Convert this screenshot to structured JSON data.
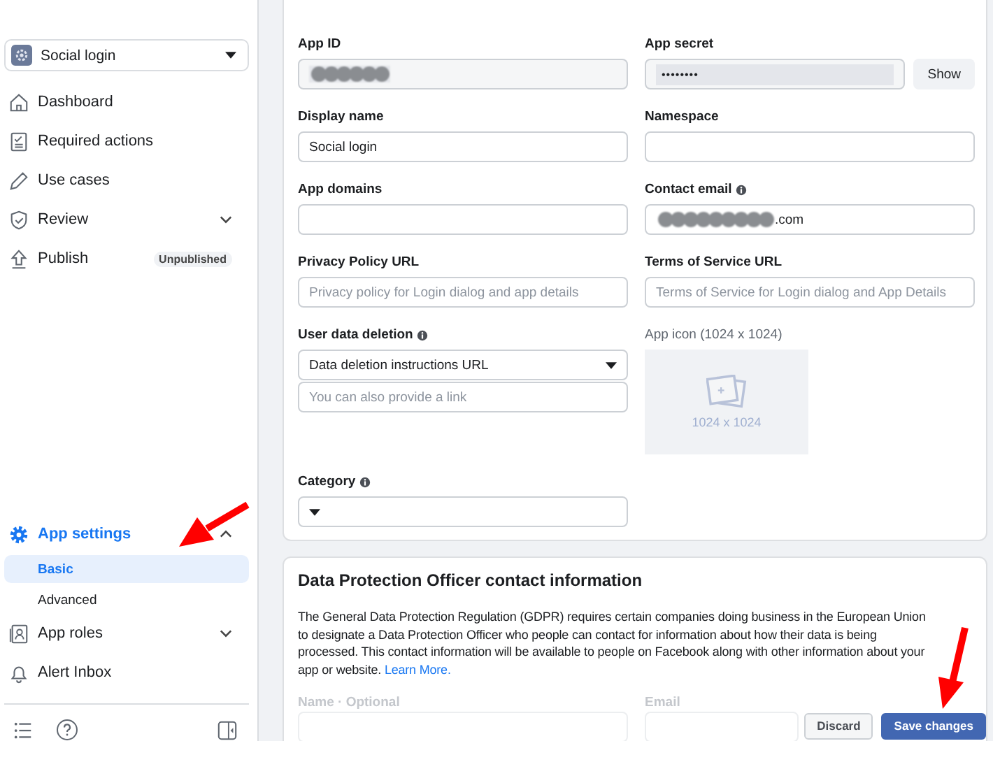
{
  "app_selector": {
    "name": "Social login"
  },
  "nav": [
    {
      "label": "Dashboard"
    },
    {
      "label": "Required actions"
    },
    {
      "label": "Use cases"
    },
    {
      "label": "Review",
      "expandable": true,
      "expanded": false
    },
    {
      "label": "Publish",
      "badge": "Unpublished"
    }
  ],
  "settings_nav": {
    "label": "App settings",
    "expanded": true,
    "children": [
      {
        "label": "Basic",
        "selected": true
      },
      {
        "label": "Advanced",
        "selected": false
      }
    ]
  },
  "nav_bottom": [
    {
      "label": "App roles",
      "expandable": true,
      "expanded": false
    },
    {
      "label": "Alert Inbox"
    }
  ],
  "basic_form": {
    "rows": [
      [
        {
          "label": "App ID",
          "kind": "text",
          "readonly": true,
          "redacted": true
        },
        {
          "label": "App secret",
          "kind": "secret",
          "readonly": true,
          "value": "••••••••",
          "button": "Show"
        }
      ],
      [
        {
          "label": "Display name",
          "kind": "text",
          "value": "Social login"
        },
        {
          "label": "Namespace",
          "kind": "text"
        }
      ],
      [
        {
          "label": "App domains",
          "kind": "text"
        },
        {
          "label": "Contact email",
          "kind": "text",
          "info": true,
          "redacted": true,
          "value": ".com"
        }
      ],
      [
        {
          "label": "Privacy Policy URL",
          "kind": "text",
          "placeholder": "Privacy policy for Login dialog and app details"
        },
        {
          "label": "Terms of Service URL",
          "kind": "text",
          "placeholder": "Terms of Service for Login dialog and App Details"
        }
      ],
      [
        {
          "label": "User data deletion",
          "kind": "select_input",
          "info": true,
          "value": "Data deletion instructions URL",
          "placeholder": "You can also provide a link"
        },
        {
          "label": "App icon (1024 x 1024)",
          "kind": "upload",
          "hint": "1024 x 1024"
        }
      ],
      [
        {
          "label": "Category",
          "kind": "select",
          "info": true
        }
      ]
    ]
  },
  "dpo": {
    "title": "Data Protection Officer contact information",
    "text": "The General Data Protection Regulation (GDPR) requires certain companies doing business in the European Union to designate a Data Protection Officer who people can contact for information about how their data is being processed. This contact information will be available to people on Facebook along with other information about your app or website.",
    "link": "Learn More.",
    "fields": [
      {
        "label": "Name · Optional"
      },
      {
        "label": "Email"
      }
    ]
  },
  "footer": {
    "buttons": [
      {
        "label": "Discard",
        "primary": false
      },
      {
        "label": "Save changes",
        "primary": true
      }
    ]
  }
}
